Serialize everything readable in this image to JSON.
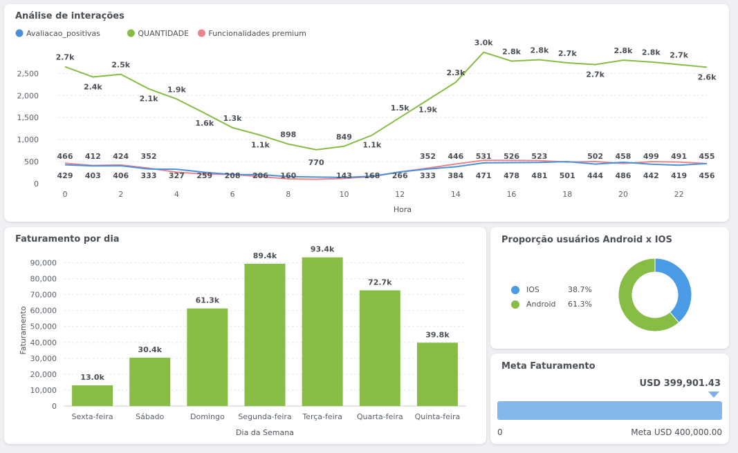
{
  "interactions": {
    "title": "Análise de interações",
    "chart_data": {
      "type": "line",
      "xlabel": "Hora",
      "ylabel": "",
      "x": [
        0,
        1,
        2,
        3,
        4,
        5,
        6,
        7,
        8,
        9,
        10,
        11,
        12,
        13,
        14,
        15,
        16,
        17,
        18,
        19,
        20,
        21,
        22,
        23
      ],
      "xticks": [
        0,
        2,
        4,
        6,
        8,
        10,
        12,
        14,
        16,
        18,
        20,
        22
      ],
      "ylim": [
        0,
        3100
      ],
      "yticks": [
        0,
        500,
        1000,
        1500,
        2000,
        2500
      ],
      "ytick_labels": [
        "0",
        "500",
        "1,000",
        "1,500",
        "2,000",
        "2,500"
      ],
      "grid": true,
      "legend": "top-left",
      "series": [
        {
          "name": "Avaliacao_positivas",
          "color": "#4a90d9",
          "values": [
            429,
            403,
            406,
            333,
            327,
            259,
            208,
            206,
            160,
            150,
            143,
            168,
            266,
            333,
            384,
            471,
            478,
            481,
            501,
            444,
            486,
            442,
            419,
            456
          ],
          "labels": [
            "429",
            "403",
            "406",
            "333",
            "327",
            "259",
            "208",
            "206",
            "160",
            "",
            "143",
            "168",
            "266",
            "333",
            "384",
            "471",
            "478",
            "481",
            "501",
            "444",
            "486",
            "442",
            "419",
            "456"
          ]
        },
        {
          "name": "QUANTIDADE",
          "color": "#87bc45",
          "values": [
            2650,
            2420,
            2480,
            2150,
            1920,
            1600,
            1270,
            1100,
            898,
            770,
            849,
            1100,
            1500,
            1900,
            2300,
            2980,
            2780,
            2810,
            2740,
            2700,
            2800,
            2760,
            2700,
            2640
          ],
          "labels": [
            "2.7k",
            "2.4k",
            "2.5k",
            "2.1k",
            "1.9k",
            "1.6k",
            "1.3k",
            "1.1k",
            "898",
            "770",
            "849",
            "1.1k",
            "1.5k",
            "1.9k",
            "2.3k",
            "3.0k",
            "2.8k",
            "2.8k",
            "2.7k",
            "2.7k",
            "2.8k",
            "2.8k",
            "2.7k",
            "2.6k"
          ]
        },
        {
          "name": "Funcionalidades premium",
          "color": "#e8858a",
          "values": [
            466,
            412,
            424,
            352,
            260,
            220,
            210,
            160,
            110,
            100,
            120,
            160,
            266,
            352,
            446,
            531,
            526,
            523,
            490,
            502,
            458,
            499,
            491,
            455
          ],
          "labels": [
            "466",
            "412",
            "424",
            "352",
            "",
            "",
            "",
            "",
            "",
            "",
            "",
            "",
            "",
            "352",
            "446",
            "531",
            "526",
            "523",
            "",
            "502",
            "458",
            "499",
            "491",
            "455"
          ]
        }
      ]
    }
  },
  "revenue": {
    "title": "Faturamento por dia",
    "chart_data": {
      "type": "bar",
      "categories": [
        "Sexta-feira",
        "Sábado",
        "Domingo",
        "Segunda-feira",
        "Terça-feira",
        "Quarta-feira",
        "Quinta-feira"
      ],
      "values": [
        13000,
        30400,
        61300,
        89400,
        93400,
        72700,
        39800
      ],
      "labels": [
        "13.0k",
        "30.4k",
        "61.3k",
        "89.4k",
        "93.4k",
        "72.7k",
        "39.8k"
      ],
      "xlabel": "Dia da Semana",
      "ylabel": "Faturamento",
      "ylim": [
        0,
        95000
      ],
      "yticks": [
        0,
        10000,
        20000,
        30000,
        40000,
        50000,
        60000,
        70000,
        80000,
        90000
      ],
      "ytick_labels": [
        "0",
        "10,000",
        "20,000",
        "30,000",
        "40,000",
        "50,000",
        "60,000",
        "70,000",
        "80,000",
        "90,000"
      ],
      "color": "#87bc45",
      "grid": true
    }
  },
  "proportion": {
    "title": "Proporção usuários Android x IOS",
    "chart_data": {
      "type": "pie",
      "donut": true,
      "legend": "left",
      "slices": [
        {
          "name": "IOS",
          "percent_label": "38.7%",
          "value": 38.7,
          "color": "#4a9be3"
        },
        {
          "name": "Android",
          "percent_label": "61.3%",
          "value": 61.3,
          "color": "#87bc45"
        }
      ]
    }
  },
  "goal": {
    "title": "Meta Faturamento",
    "value_label": "USD 399,901.43",
    "zero_label": "0",
    "target_label": "Meta USD 400,000.00",
    "progress": 0.99975,
    "bar_color": "#85b8ea"
  }
}
